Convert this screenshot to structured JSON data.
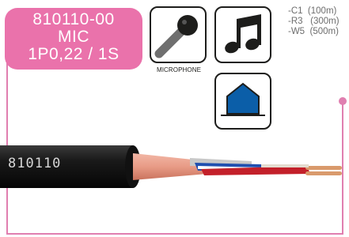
{
  "label": {
    "part_number": "810110-00",
    "type": "MIC",
    "spec": "1P0,22 / 1S",
    "background_color": "#ea72ab"
  },
  "icons": [
    {
      "name": "microphone-icon",
      "caption": "MICROPHONE"
    },
    {
      "name": "music-note-icon"
    },
    {
      "name": "shielded-house-icon"
    }
  ],
  "length_codes": [
    {
      "code": "-C1",
      "length": "(100m)"
    },
    {
      "code": "-R3",
      "length": "(300m)"
    },
    {
      "code": "-W5",
      "length": "(500m)"
    }
  ],
  "cable": {
    "print_text": "810110"
  },
  "colors": {
    "frame": "#e07fb0",
    "cable_jacket": "#1a1a1a",
    "shield_fill": "#0b5ea8"
  }
}
